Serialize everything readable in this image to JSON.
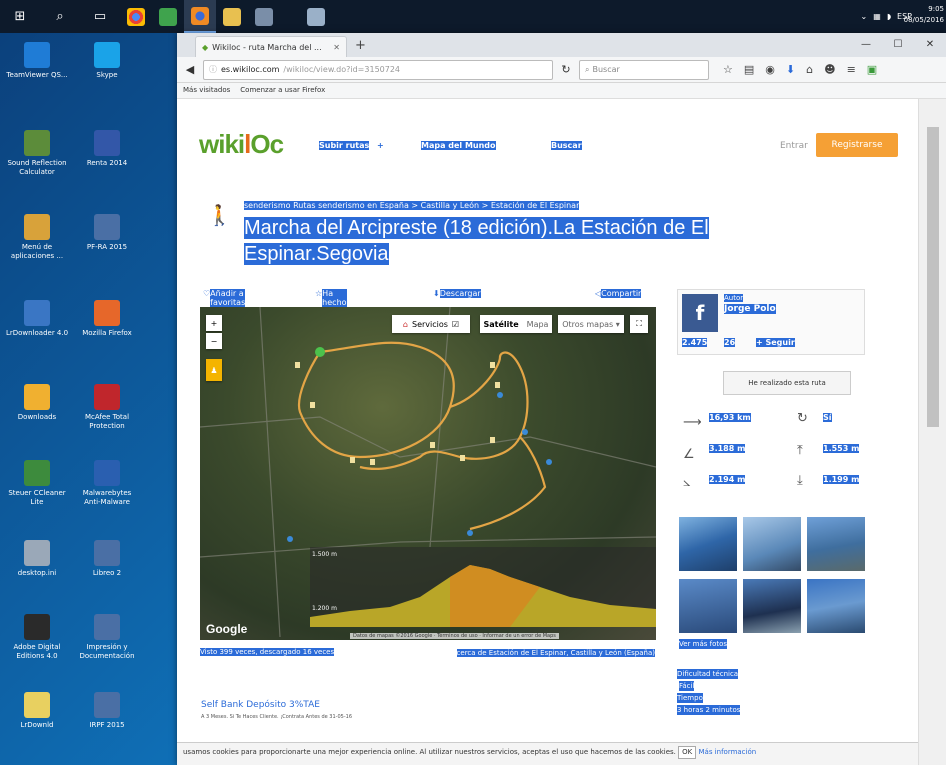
{
  "taskbar": {
    "tray_lang": "ESP",
    "clock_time": "9:05",
    "clock_date": "08/05/2016"
  },
  "desktop_icons": [
    {
      "label": "TeamViewer QS...",
      "color": "#1f7cd6"
    },
    {
      "label": "Skype",
      "color": "#1aa3e8"
    },
    {
      "label": "Sound Reflection Calculator",
      "color": "#5c8c3a"
    },
    {
      "label": "Renta 2014",
      "color": "#3357a8"
    },
    {
      "label": "Menú de aplicaciones ...",
      "color": "#d8a23a"
    },
    {
      "label": "PF-RA 2015",
      "color": "#4a6fa5"
    },
    {
      "label": "LrDownloader 4.0",
      "color": "#3a76c4"
    },
    {
      "label": "Mozilla Firefox",
      "color": "#e6672a"
    },
    {
      "label": "Downloads",
      "color": "#f0b030"
    },
    {
      "label": "McAfee Total Protection",
      "color": "#c0262c"
    },
    {
      "label": "Steuer CCleaner Lite",
      "color": "#3d8b3d"
    },
    {
      "label": "Malwarebytes Anti-Malware",
      "color": "#2a5fb0"
    },
    {
      "label": "desktop.ini",
      "color": "#9aa8b8"
    },
    {
      "label": "Libreo 2",
      "color": "#4a6fa5"
    },
    {
      "label": "Adobe Digital Editions 4.0",
      "color": "#2a2a2a"
    },
    {
      "label": "Impresión y Documentación",
      "color": "#4a6fa5"
    },
    {
      "label": "LrDownld",
      "color": "#e8d060"
    },
    {
      "label": "IRPF 2015",
      "color": "#4a6fa5"
    }
  ],
  "browser": {
    "tab_title": "Wikiloc - ruta Marcha del ...",
    "url_domain": "es.wikiloc.com",
    "url_rest": "/wikiloc/view.do?id=3150724",
    "search_placeholder": "Buscar",
    "bookmark_1": "Más visitados",
    "bookmark_2": "Comenzar a usar Firefox"
  },
  "site": {
    "logo_a": "wiki",
    "logo_b": "l",
    "logo_c": "Oc",
    "nav_upload": "Subir rutas",
    "nav_world_map": "Mapa del Mundo",
    "nav_search": "Buscar",
    "login": "Entrar",
    "register": "Registrarse"
  },
  "trail": {
    "breadcrumb": "senderismo Rutas senderismo en España > Castilla y León > Estación de El Espinar",
    "title": "Marcha del Arcipreste (18 edición).La Estación de El Espinar.Segovia",
    "add_favorite": "Añadir a favoritas",
    "mark_done": "Ha hecho esta ruta",
    "download": "Descargar",
    "share": "Compartir",
    "views": "Visto 399 veces, descargado 16 veces",
    "near": "cerca de Estación de El Espinar, Castilla y León (España)"
  },
  "map": {
    "services": "Servicios",
    "terrain": "Satélite",
    "map_type": "Mapa",
    "other_maps": "Otros mapas",
    "google": "Google",
    "footer": "Datos de mapas ©2016 Google · Términos de uso · Informar de un error de Maps",
    "elev_top": "1.500 m",
    "elev_bottom": "1.200 m"
  },
  "author": {
    "label": "Autor",
    "name": "Jorge Polo",
    "routes": "2.475",
    "followers": "26",
    "following": "+ Seguir"
  },
  "stats": {
    "distance": "16,93 km",
    "loop": "Sí",
    "elev_gain": "3.188 m",
    "max_alt": "1.553 m",
    "elev_loss": "2.194 m",
    "min_alt": "1.199 m"
  },
  "done_button": "He realizado esta ruta",
  "see_photos": "Ver más fotos",
  "side_tags": [
    "Dificultad técnica",
    "Fácil",
    "Tiempo",
    "3 horas 2 minutos"
  ],
  "ad": {
    "title": "Self Bank Depósito 3%TAE",
    "subtitle": "A 3 Meses. Si Te Haces Cliente. ¡Contrata Antes de 31-05-16"
  },
  "cookie": {
    "text": "usamos cookies para proporcionarte una mejor experiencia online. Al utilizar nuestros servicios, aceptas el uso que hacemos de las cookies.",
    "ok": "OK",
    "more": "Más información"
  }
}
